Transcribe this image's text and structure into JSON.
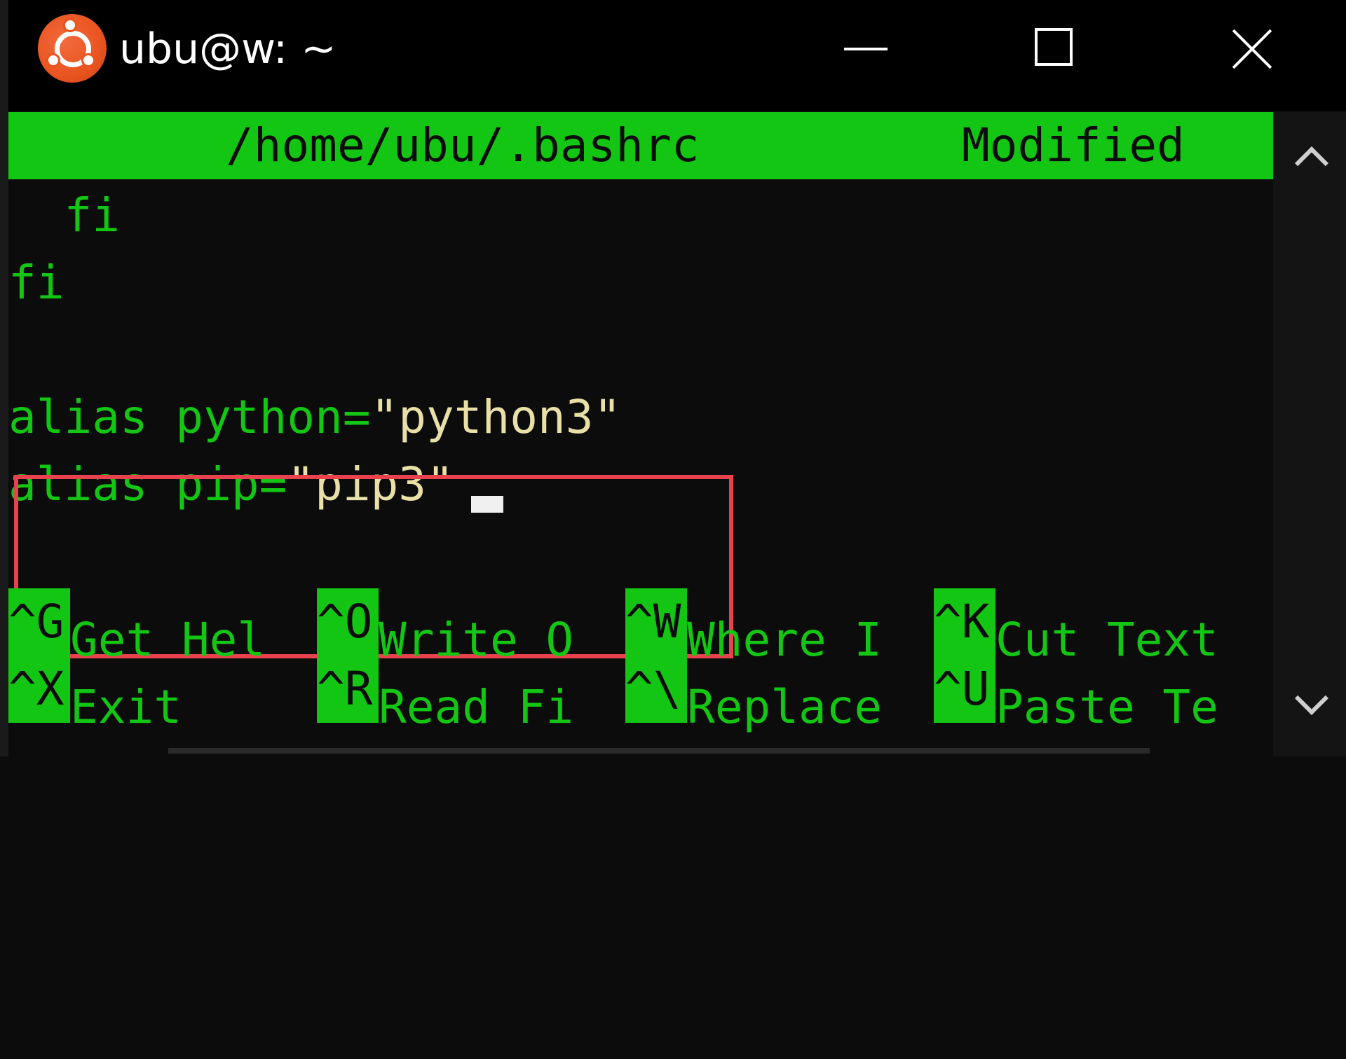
{
  "window": {
    "title": "ubu@w: ~",
    "app_icon": "ubuntu-logo-icon",
    "controls": [
      "minimize-icon",
      "maximize-icon",
      "close-icon"
    ]
  },
  "editor": {
    "header": {
      "filename": "/home/ubu/.bashrc",
      "state": "Modified"
    },
    "lines": [
      {
        "indent": "  ",
        "text": "fi"
      },
      {
        "indent": "",
        "text": "fi"
      },
      {
        "indent": "",
        "text": ""
      },
      {
        "code": "alias python=",
        "string": "\"python3\""
      },
      {
        "code": "alias pip=",
        "string": "\"pip3\""
      }
    ],
    "shortcuts_row1": [
      {
        "key": "^G",
        "label": "Get Hel"
      },
      {
        "key": "^O",
        "label": "Write O"
      },
      {
        "key": "^W",
        "label": "Where I"
      },
      {
        "key": "^K",
        "label": "Cut Text"
      }
    ],
    "shortcuts_row2": [
      {
        "key": "^X",
        "label": "Exit"
      },
      {
        "key": "^R",
        "label": "Read Fi"
      },
      {
        "key": "^\\",
        "label": "Replace"
      },
      {
        "key": "^U",
        "label": "Paste Te"
      }
    ]
  },
  "colors": {
    "nano_green": "#13c613",
    "string_color": "#e8e0a6",
    "highlight_border": "#e8434c",
    "background": "#0c0c0c"
  }
}
